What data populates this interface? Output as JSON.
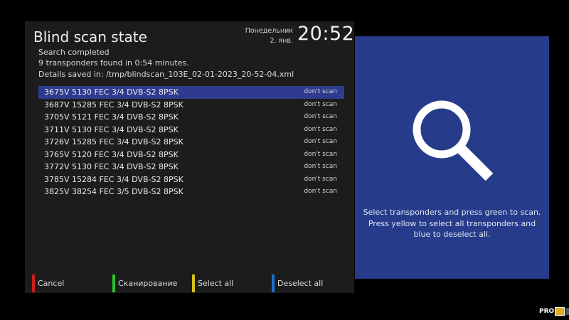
{
  "header": {
    "title": "Blind scan state",
    "day": "Понедельник",
    "date": "2. янв.",
    "time": "20:52"
  },
  "status": {
    "line1": "Search completed",
    "line2": "9 transponders found in 0:54 minutes.",
    "line3": "Details saved in: /tmp/blindscan_103E_02-01-2023_20-52-04.xml"
  },
  "transponders": [
    {
      "label": "3675V 5130 FEC 3/4 DVB-S2 8PSK",
      "state": "don't scan"
    },
    {
      "label": "3687V 15285 FEC 3/4 DVB-S2 8PSK",
      "state": "don't scan"
    },
    {
      "label": "3705V 5121 FEC 3/4 DVB-S2 8PSK",
      "state": "don't scan"
    },
    {
      "label": "3711V 5130 FEC 3/4 DVB-S2 8PSK",
      "state": "don't scan"
    },
    {
      "label": "3726V 15285 FEC 3/4 DVB-S2 8PSK",
      "state": "don't scan"
    },
    {
      "label": "3765V 5120 FEC 3/4 DVB-S2 8PSK",
      "state": "don't scan"
    },
    {
      "label": "3772V 5130 FEC 3/4 DVB-S2 8PSK",
      "state": "don't scan"
    },
    {
      "label": "3785V 15284 FEC 3/4 DVB-S2 8PSK",
      "state": "don't scan"
    },
    {
      "label": "3825V 38254 FEC 3/5 DVB-S2 8PSK",
      "state": "don't scan"
    }
  ],
  "buttons": {
    "red": {
      "label": "Cancel",
      "color": "#c81e1e"
    },
    "green": {
      "label": "Сканирование",
      "color": "#2cc22c"
    },
    "yellow": {
      "label": "Select all",
      "color": "#d6c21a"
    },
    "blue": {
      "label": "Deselect all",
      "color": "#1e6fd0"
    }
  },
  "help": {
    "icon": "search-icon",
    "text": "Select transponders and press green to scan. Press yellow to select all transponders and blue to deselect all."
  },
  "watermark": {
    "text": "PRO"
  },
  "colors": {
    "panel_bg": "#1c1c1c",
    "selected_row": "#2e3b8e",
    "help_bg": "#263c8a"
  }
}
